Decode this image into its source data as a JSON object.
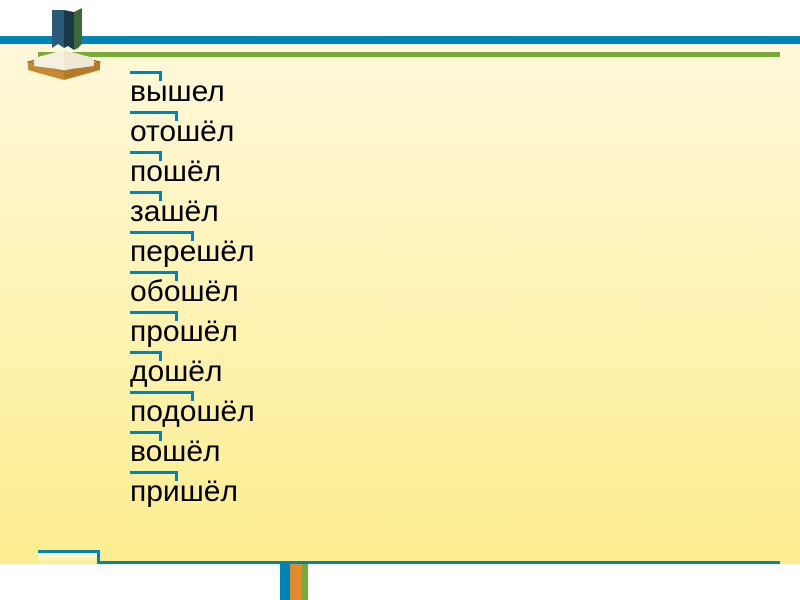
{
  "words": [
    {
      "text": "вышел",
      "prefix_len": 2
    },
    {
      "text": "отошёл",
      "prefix_len": 3
    },
    {
      "text": "пошёл",
      "prefix_len": 2
    },
    {
      "text": "зашёл",
      "prefix_len": 2
    },
    {
      "text": "перешёл",
      "prefix_len": 4
    },
    {
      "text": "обошёл",
      "prefix_len": 3
    },
    {
      "text": "прошёл",
      "prefix_len": 3
    },
    {
      "text": "дошёл",
      "prefix_len": 2
    },
    {
      "text": "подошёл",
      "prefix_len": 4
    },
    {
      "text": "вошёл",
      "prefix_len": 2
    },
    {
      "text": "пришёл",
      "prefix_len": 3
    }
  ],
  "colors": {
    "accent_blue": "#0084b5",
    "accent_green": "#77a93b",
    "accent_orange": "#e28a2b"
  },
  "icon": "books-icon"
}
